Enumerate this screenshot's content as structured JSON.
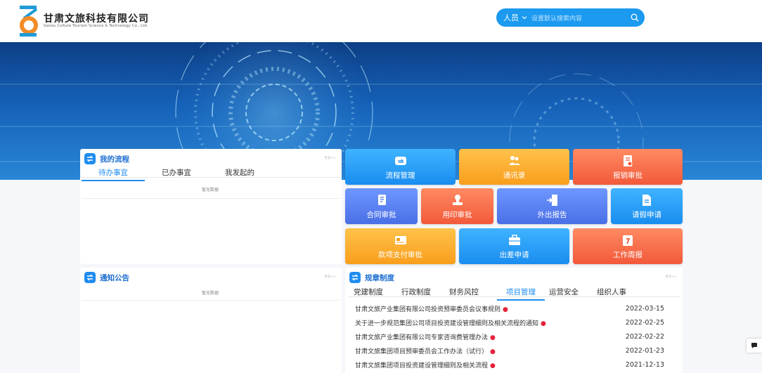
{
  "header": {
    "company_name": "甘肃文旅科技有限公司",
    "company_name_en": "Gansu Culture Tourism Science & Technology Co., Ltd.",
    "search": {
      "category": "人员",
      "placeholder": "设置默认搜索内容"
    }
  },
  "workflow": {
    "title": "我的流程",
    "more": "更多>>",
    "tabs": [
      "待办事宜",
      "已办事宜",
      "我发起的"
    ],
    "active_tab": 0,
    "empty_text": "暂无数据"
  },
  "notice": {
    "title": "通知公告",
    "more": "更多>>",
    "empty_text": "暂无数据"
  },
  "quick_tiles": [
    {
      "label": "流程管理",
      "icon": "flow-icon",
      "color": "#1a8df0"
    },
    {
      "label": "通讯录",
      "icon": "contacts-icon",
      "color": "#f99e1c"
    },
    {
      "label": "报销审批",
      "icon": "reimburse-icon",
      "color": "#f2593a"
    },
    {
      "label": "合同审批",
      "icon": "contract-icon",
      "color": "#4a6fe6"
    },
    {
      "label": "用印审批",
      "icon": "seal-icon",
      "color": "#f2593a"
    },
    {
      "label": "外出报告",
      "icon": "exit-icon",
      "color": "#4a6fe6"
    },
    {
      "label": "请假申请",
      "icon": "leave-icon",
      "color": "#1a8df0"
    },
    {
      "label": "款项支付审批",
      "icon": "payment-icon",
      "color": "#f99e1c"
    },
    {
      "label": "出差申请",
      "icon": "briefcase-icon",
      "color": "#1a8df0"
    },
    {
      "label": "工作周报",
      "icon": "calendar-icon",
      "color": "#f2593a"
    }
  ],
  "rules": {
    "title": "规章制度",
    "more": "更多>>",
    "tabs": [
      "党建制度",
      "行政制度",
      "财务风控",
      "项目管理",
      "运营安全",
      "组织人事"
    ],
    "active_tab": 3,
    "items": [
      {
        "title": "甘肃文旅产业集团有限公司投资预审委员会议事规则",
        "date": "2022-03-15"
      },
      {
        "title": "关于进一步规范集团公司项目投资建设管理细则及相关流程的通知",
        "date": "2022-02-25"
      },
      {
        "title": "甘肃文旅产业集团有限公司专家咨询费管理办法",
        "date": "2022-02-22"
      },
      {
        "title": "甘肃文旅集团项目预审委员会工作办法（试行）",
        "date": "2022-01-23"
      },
      {
        "title": "甘肃文旅集团项目投资建设管理细则及相关流程",
        "date": "2021-12-13"
      }
    ]
  },
  "colors": {
    "accent": "#1f8cf0",
    "new_dot": "#e5223a"
  }
}
